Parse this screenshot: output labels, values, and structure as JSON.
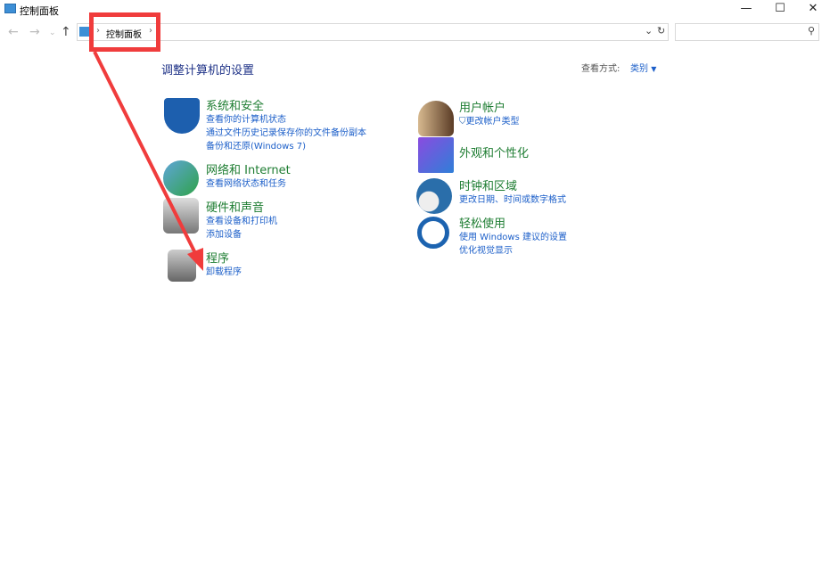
{
  "window": {
    "title": "控制面板",
    "minimize": "—",
    "maximize": "☐",
    "close": "✕"
  },
  "address": {
    "crumb": "控制面板",
    "sep": "›",
    "search_placeholder": ""
  },
  "main": {
    "heading": "调整计算机的设置",
    "view_label": "查看方式:",
    "view_value": "类别"
  },
  "categories": [
    {
      "title": "系统和安全",
      "links": [
        "查看你的计算机状态",
        "通过文件历史记录保存你的文件备份副本",
        "备份和还原(Windows 7)"
      ]
    },
    {
      "title": "网络和 Internet",
      "links": [
        "查看网络状态和任务"
      ]
    },
    {
      "title": "硬件和声音",
      "links": [
        "查看设备和打印机",
        "添加设备"
      ]
    },
    {
      "title": "程序",
      "links": [
        "卸载程序"
      ]
    },
    {
      "title": "用户帐户",
      "links": [
        "更改帐户类型"
      ]
    },
    {
      "title": "外观和个性化",
      "links": []
    },
    {
      "title": "时钟和区域",
      "links": [
        "更改日期、时间或数字格式"
      ]
    },
    {
      "title": "轻松使用",
      "links": [
        "使用 Windows 建议的设置",
        "优化视觉显示"
      ]
    }
  ],
  "colors": {
    "annotation": "#f03c3c",
    "link": "#1c5fc9",
    "category": "#1e7d32"
  }
}
